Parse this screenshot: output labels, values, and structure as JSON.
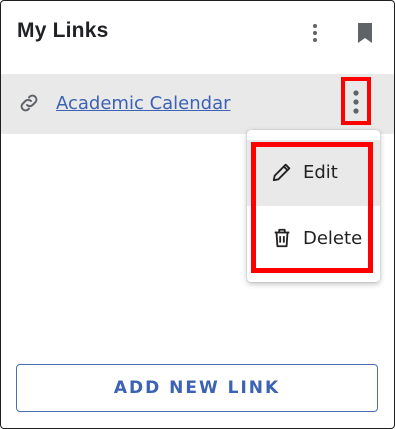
{
  "header": {
    "title": "My Links",
    "menu_icon": "more-vertical-icon",
    "bookmark_icon": "bookmark-icon"
  },
  "links": [
    {
      "label": "Academic Calendar",
      "icon": "link-icon",
      "menu_icon": "more-vertical-icon"
    }
  ],
  "context_menu": {
    "items": [
      {
        "label": "Edit",
        "icon": "pencil-icon"
      },
      {
        "label": "Delete",
        "icon": "trash-icon"
      }
    ]
  },
  "footer": {
    "add_button_label": "ADD NEW LINK"
  },
  "colors": {
    "link": "#3c62b4",
    "highlight": "#ff0000",
    "row_bg": "#e9e9e9"
  }
}
